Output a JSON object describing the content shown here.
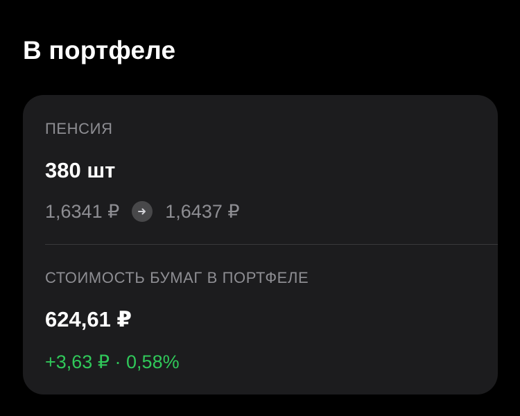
{
  "header": {
    "title": "В портфеле"
  },
  "card": {
    "instrument_label": "ПЕНСИЯ",
    "quantity": "380 шт",
    "price_from": "1,6341 ₽",
    "price_to": "1,6437 ₽",
    "arrow_icon": "arrow-right-icon",
    "value_label": "СТОИМОСТЬ БУМАГ В ПОРТФЕЛЕ",
    "total_value": "624,61 ₽",
    "change_amount": "+3,63 ₽",
    "change_separator": "·",
    "change_percent": "0,58%"
  },
  "colors": {
    "background": "#000000",
    "card": "#1c1c1e",
    "secondary_text": "#8e8e93",
    "positive": "#30c85a"
  }
}
